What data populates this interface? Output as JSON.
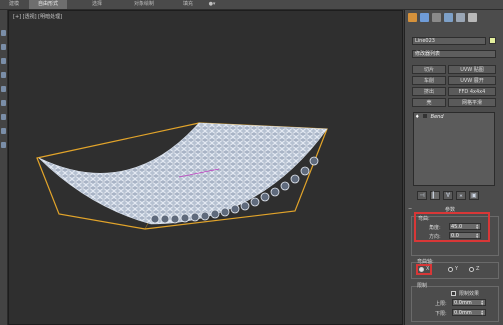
{
  "menu": {
    "items": [
      "建模",
      "自由形式",
      "选择",
      "对象绘制",
      "填充",
      "●▾"
    ],
    "active_index": 1
  },
  "viewport": {
    "label": "[+] [透视] [明暗处理]"
  },
  "panel": {
    "object_name": "Line023",
    "modifier_list": "修改器列表",
    "color_swatch": "#e3ef9d",
    "buttons": [
      [
        "切片",
        "UVW 贴图"
      ],
      [
        "车削",
        "UVW 展开"
      ],
      [
        "挤出",
        "FFD 4x4x4"
      ],
      [
        "壳",
        "网格平滑"
      ]
    ],
    "stack_item": "Bend",
    "stack_tools": [
      "⊣",
      "▎",
      "∀",
      "⁎",
      "▣"
    ],
    "rollout_title": "参数",
    "bend_group_label": "弯曲:",
    "angle_label": "角度:",
    "angle_value": "45.0",
    "direction_label": "方向:",
    "direction_value": "0.0",
    "axis_group_label": "弯曲轴:",
    "axes": [
      "X",
      "Y",
      "Z"
    ],
    "selected_axis": "X",
    "limit_group_label": "限制",
    "limit_checkbox": "限制效果",
    "upper_label": "上限:",
    "upper_value": "0.0mm",
    "lower_label": "下限:",
    "lower_value": "0.0mm"
  }
}
